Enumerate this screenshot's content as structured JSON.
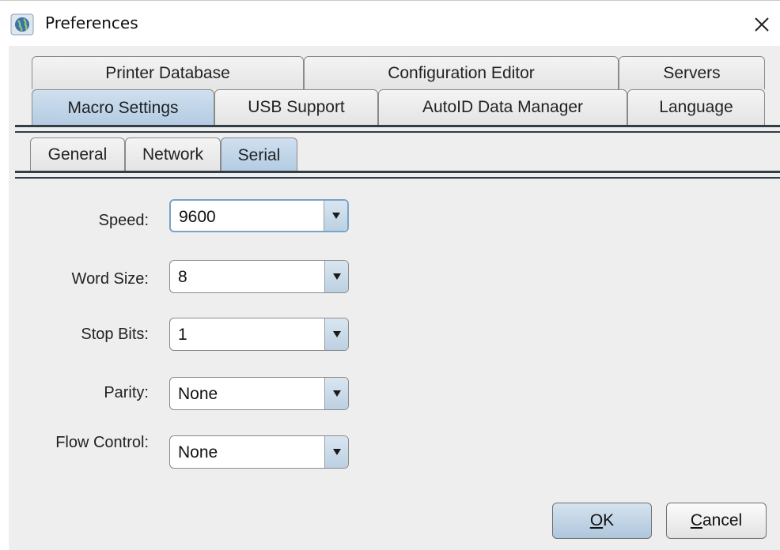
{
  "window": {
    "title": "Preferences",
    "app_icon": "globe-icon",
    "close_icon": "close-icon"
  },
  "tabs_top_row": [
    {
      "label": "Printer Database"
    },
    {
      "label": "Configuration Editor"
    },
    {
      "label": "Servers"
    }
  ],
  "tabs_bottom_row": [
    {
      "label": "Macro Settings",
      "selected": true
    },
    {
      "label": "USB Support"
    },
    {
      "label": "AutoID Data Manager"
    },
    {
      "label": "Language"
    }
  ],
  "subtabs": [
    {
      "label": "General"
    },
    {
      "label": "Network"
    },
    {
      "label": "Serial",
      "selected": true
    }
  ],
  "form": {
    "speed": {
      "label": "Speed:",
      "value": "9600"
    },
    "word_size": {
      "label": "Word Size:",
      "value": "8"
    },
    "stop_bits": {
      "label": "Stop Bits:",
      "value": "1"
    },
    "parity": {
      "label": "Parity:",
      "value": "None"
    },
    "flow_control": {
      "label": "Flow Control:",
      "value": "None"
    }
  },
  "buttons": {
    "ok": {
      "mnemonic": "O",
      "rest": "K"
    },
    "cancel": {
      "mnemonic": "C",
      "rest": "ancel"
    }
  },
  "colors": {
    "selected_tab": "#b3cbe2",
    "background": "#eeeeee",
    "divider": "#333d47"
  }
}
